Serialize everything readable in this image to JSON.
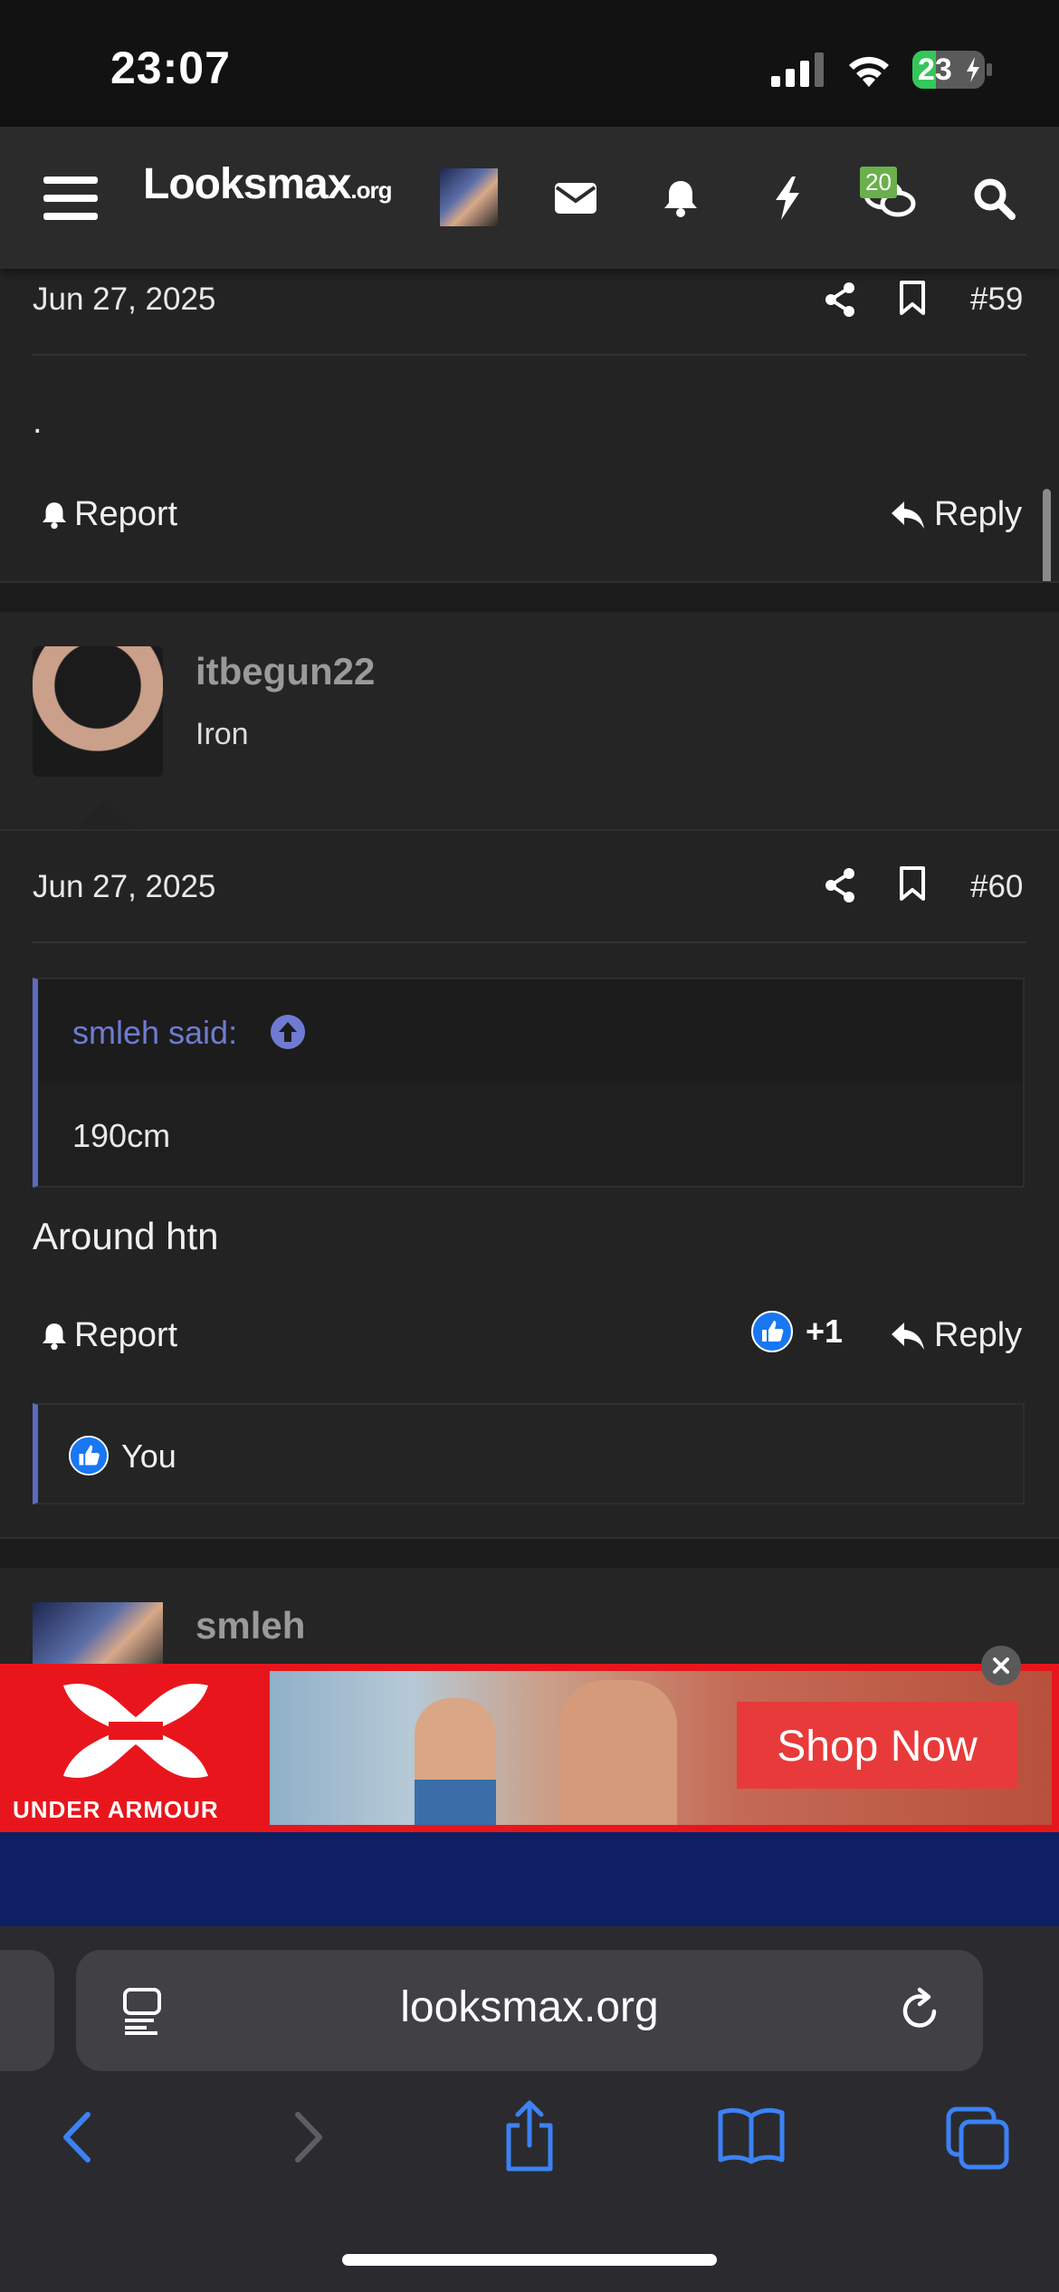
{
  "status_bar": {
    "time": "23:07",
    "battery": "23"
  },
  "navbar": {
    "logo_main": "Looksmax",
    "logo_suffix": ".org",
    "chat_badge": "20",
    "icons": [
      "menu-icon",
      "avatar",
      "mail-icon",
      "bell-icon",
      "lightning-icon",
      "chat-icon",
      "search-icon"
    ]
  },
  "post_59": {
    "date": "Jun 27, 2025",
    "number": "#59",
    "content": ".",
    "report_label": "Report",
    "reply_label": "Reply"
  },
  "post_60": {
    "username": "itbegun22",
    "user_title": "Iron",
    "date": "Jun 27, 2025",
    "number": "#60",
    "quote_author": "smleh said:",
    "quote_text": "190cm",
    "content": "Around htn",
    "report_label": "Report",
    "reaction_count": "+1",
    "reply_label": "Reply",
    "reactions_by": "You"
  },
  "post_61": {
    "username": "smleh"
  },
  "ad": {
    "brand": "UNDER ARMOUR",
    "cta": "Shop Now",
    "colors": {
      "background": "#e8161c",
      "cta_bg": "#e83a3a"
    }
  },
  "browser": {
    "url": "looksmax.org"
  },
  "colors": {
    "accent": "#5c6bc0",
    "like_blue": "#1877f2",
    "toolbar_blue": "#3b82f6"
  }
}
